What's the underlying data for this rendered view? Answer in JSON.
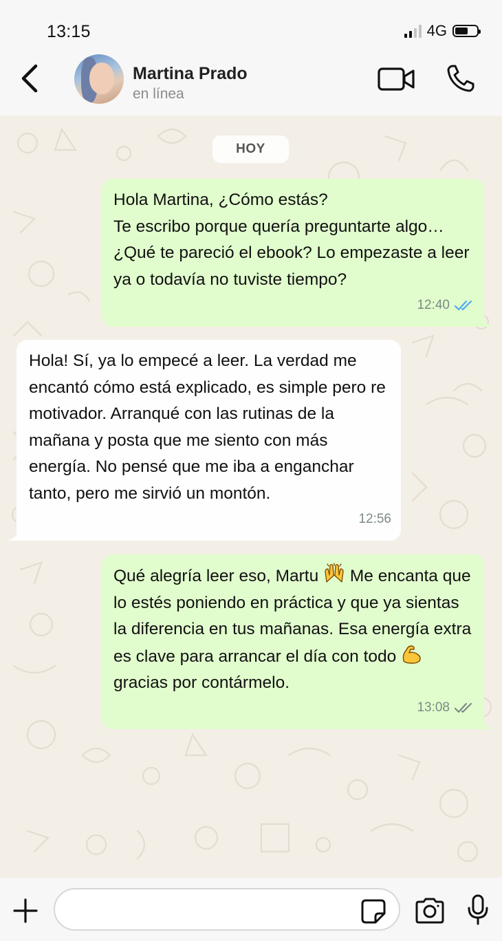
{
  "status_bar": {
    "time": "13:15",
    "network": "4G"
  },
  "header": {
    "contact_name": "Martina Prado",
    "contact_status": "en línea"
  },
  "date_separator": "HOY",
  "messages": [
    {
      "direction": "outgoing",
      "text": "Hola Martina, ¿Cómo estás?\nTe escribo porque quería preguntarte algo… ¿Qué te pareció el ebook? Lo empezaste a leer ya o todavía no tuviste tiempo?",
      "time": "12:40",
      "receipt": "read"
    },
    {
      "direction": "incoming",
      "text": "Hola! Sí, ya lo empecé a leer. La verdad me encantó cómo está explicado, es simple pero re motivador. Arranqué con las rutinas de la mañana y posta que me siento con más energía. No pensé que me iba a enganchar tanto, pero me sirvió un montón.",
      "time": "12:56"
    },
    {
      "direction": "outgoing",
      "text_part1": "Qué alegría leer eso, Martu",
      "emoji1": "raising-hands",
      "text_part2": " Me encanta que lo estés poniendo en práctica y que ya sientas la diferencia en tus mañanas. Esa energía extra es clave para arrancar el día con todo",
      "emoji2": "flexed-biceps",
      "text_part3": " gracias por contármelo.",
      "time": "13:08",
      "receipt": "delivered"
    }
  ],
  "composer": {
    "placeholder": ""
  },
  "colors": {
    "outgoing_bubble": "#e1fdcd",
    "incoming_bubble": "#fefefe",
    "read_ticks": "#4fa9ef",
    "chat_background": "#f3efe6"
  }
}
